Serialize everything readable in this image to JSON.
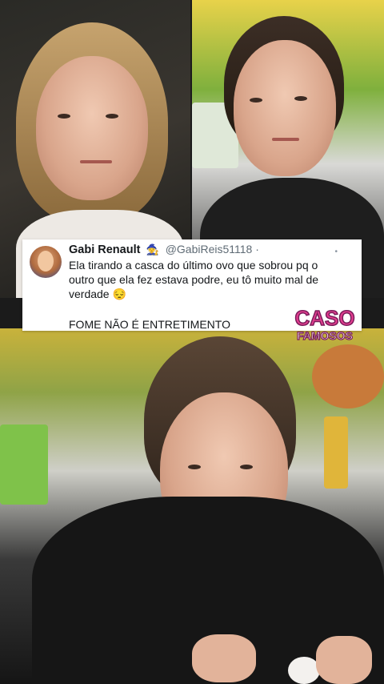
{
  "tweet": {
    "display_name": "Gabi Renault",
    "badge_icon": "witch-hat-emoji",
    "badge_emoji": "🧙",
    "handle": "@GabiReis51118 ·",
    "line1": "Ela tirando a casca do último ovo que sobrou pq o",
    "line2": "outro que ela fez estava podre, eu tô muito mal de",
    "line3": "verdade 😔",
    "line4": "FOME NÃO É ENTRETIMENTO"
  },
  "watermark": {
    "top_word": "CASO",
    "bottom_word": "FAMOSOS",
    "colors": {
      "top": "#e23d8f",
      "bottom": "#ffffff",
      "stroke": "#7a1c5a"
    }
  }
}
